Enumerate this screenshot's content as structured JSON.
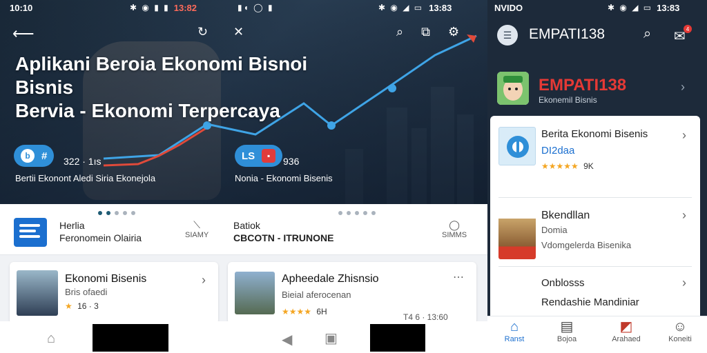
{
  "left": {
    "status_time": "10:10",
    "hero_title_lines": [
      "Aplikani Beroia Ekonomi Bisnoi",
      "Bisnis",
      "Bervia - Ekonomi Terpercaya"
    ],
    "pill1_icon": "b",
    "pill1_text": "#",
    "count1": "322 · 1ıs",
    "caption1": "Bertii Ekonont Aledi Siria Ekonejola",
    "strip_title_line1": "Herlia",
    "strip_title_line2": "Feronomein Olairia",
    "strip_side_label": "SIAMY",
    "card_title": "Ekonomi Bisenis",
    "card_sub": "Bris ofaedi",
    "card_rating": "16 · 3",
    "nav_icons": [
      "back-arrow-icon",
      "refresh-icon"
    ]
  },
  "middle": {
    "status_time": "13:82",
    "pill2_icon": "LS",
    "count2": "936",
    "caption2": "Nonia - Ekonomi Bisenis",
    "strip_title_line1": "Batiok",
    "strip_title_line2": "CBCOTN - ITRUNONE",
    "strip_side_label": "SIMMS",
    "card_title": "Apheedale Zhisnsio",
    "card_sub": "Bieial aferocenan",
    "card_rating": "6H",
    "card_meta": "T4 6 · 13:60",
    "nav_icons": [
      "share-icon",
      "search-icon",
      "crop-icon",
      "settings-icon"
    ]
  },
  "right": {
    "status_time": "13:83",
    "app_title": "EMPATI138",
    "brand_name": "EMPATI138",
    "brand_sub": "Ekonemil Bisnis",
    "rows": [
      {
        "title": "Berita Ekonomi Bisenis",
        "sub": "DI2daa",
        "rating": "9K"
      },
      {
        "title": "Bkendllan",
        "sub": "Domia",
        "sub2": "Vdomgelerda Bisenika"
      },
      {
        "title": "Onblosss",
        "sub": "Rendashie Mandiniar"
      }
    ],
    "badge": "4",
    "tabs": [
      {
        "label": "Ranst",
        "icon": "home-icon"
      },
      {
        "label": "Bojoa",
        "icon": "card-icon"
      },
      {
        "label": "Arahaed",
        "icon": "chart-icon"
      },
      {
        "label": "Koneiti",
        "icon": "profile-icon"
      }
    ]
  },
  "colors": {
    "accent": "#1b6fcf",
    "brand_red": "#e53935",
    "star": "#f4a623",
    "hero_dark": "#1a2a3a"
  }
}
